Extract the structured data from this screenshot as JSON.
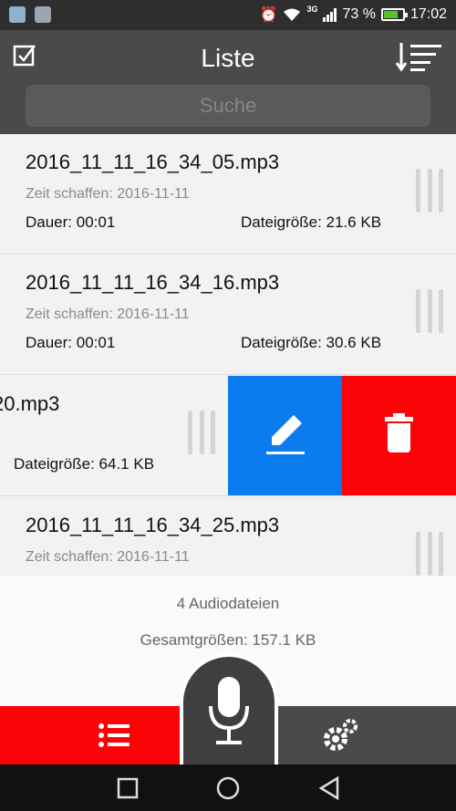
{
  "status": {
    "battery_percent": "73 %",
    "time": "17:02",
    "network": "3G",
    "battery_level": 0.73
  },
  "header": {
    "title": "Liste",
    "search_placeholder": "Suche"
  },
  "files": [
    {
      "name": "2016_11_11_16_34_05.mp3",
      "created": "Zeit schaffen: 2016-11-11",
      "duration": "Dauer: 00:01",
      "size": "Dateigröße: 21.6 KB"
    },
    {
      "name": "2016_11_11_16_34_16.mp3",
      "created": "Zeit schaffen: 2016-11-11",
      "duration": "Dauer: 00:01",
      "size": "Dateigröße: 30.6 KB"
    },
    {
      "name": "20.mp3",
      "size": "Dateigröße: 64.1 KB"
    },
    {
      "name": "2016_11_11_16_34_25.mp3",
      "created": "Zeit schaffen: 2016-11-11"
    }
  ],
  "summary": {
    "count": "4 Audiodateien",
    "total": "Gesamtgrößen: 157.1 KB"
  },
  "colors": {
    "accent_red": "#fb0307",
    "edit_blue": "#0a7cf0",
    "header_gray": "#4a4a4a"
  },
  "icons": {
    "select": "checkbox-icon",
    "sort": "sort-icon",
    "edit": "pencil-icon",
    "delete": "trash-icon",
    "list": "list-icon",
    "record": "microphone-icon",
    "settings": "gears-icon"
  }
}
